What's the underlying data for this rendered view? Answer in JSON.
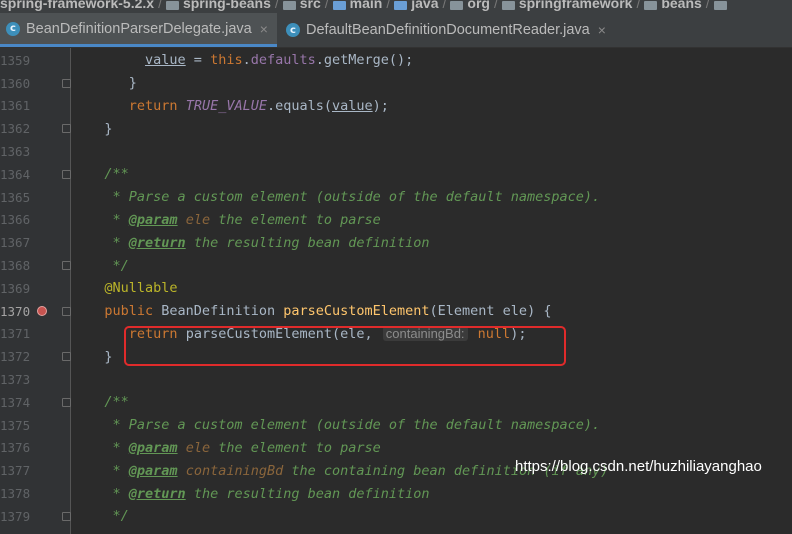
{
  "breadcrumb": {
    "items": [
      "spring-framework-5.2.x",
      "spring-beans",
      "src",
      "main",
      "java",
      "org",
      "springframework",
      "beans",
      ""
    ]
  },
  "tabs": [
    {
      "label": "BeanDefinitionParserDelegate.java",
      "icon": "class-icon",
      "active": true,
      "close": "×"
    },
    {
      "label": "DefaultBeanDefinitionDocumentReader.java",
      "icon": "class-icon",
      "active": false,
      "close": "×"
    }
  ],
  "editor": {
    "lines": [
      {
        "n": "1359",
        "tokens": [
          [
            "        ",
            ""
          ],
          [
            "value",
            "field-u"
          ],
          [
            " = ",
            "ident"
          ],
          [
            "this",
            "kw"
          ],
          [
            ".",
            "ident"
          ],
          [
            "defaults",
            "const2"
          ],
          [
            ".getMerge();",
            "ident"
          ]
        ]
      },
      {
        "n": "1360",
        "tokens": [
          [
            "      }",
            "ident"
          ]
        ]
      },
      {
        "n": "1361",
        "tokens": [
          [
            "      ",
            ""
          ],
          [
            "return ",
            "kw"
          ],
          [
            "TRUE_VALUE",
            "const"
          ],
          [
            ".equals(",
            "ident"
          ],
          [
            "value",
            "field-u"
          ],
          [
            ");",
            "ident"
          ]
        ]
      },
      {
        "n": "1362",
        "tokens": [
          [
            "   }",
            "ident"
          ]
        ]
      },
      {
        "n": "1363",
        "tokens": []
      },
      {
        "n": "1364",
        "tokens": [
          [
            "   /**",
            "doc"
          ]
        ]
      },
      {
        "n": "1365",
        "tokens": [
          [
            "    * Parse a custom element (outside of the default namespace).",
            "doc"
          ]
        ]
      },
      {
        "n": "1366",
        "tokens": [
          [
            "    * ",
            "doc"
          ],
          [
            "@param",
            "doctag"
          ],
          [
            " ",
            "doc"
          ],
          [
            "ele",
            "docparam"
          ],
          [
            " the element to parse",
            "doc"
          ]
        ]
      },
      {
        "n": "1367",
        "tokens": [
          [
            "    * ",
            "doc"
          ],
          [
            "@return",
            "doctag"
          ],
          [
            " the resulting bean definition",
            "doc"
          ]
        ]
      },
      {
        "n": "1368",
        "tokens": [
          [
            "    */",
            "doc"
          ]
        ]
      },
      {
        "n": "1369",
        "tokens": [
          [
            "   ",
            ""
          ],
          [
            "@Nullable",
            "annot"
          ]
        ]
      },
      {
        "n": "1370",
        "tokens": [
          [
            "   ",
            ""
          ],
          [
            "public ",
            "kw"
          ],
          [
            "BeanDefinition ",
            "ident"
          ],
          [
            "parseCustomElement",
            "fn"
          ],
          [
            "(Element ele) {",
            "ident"
          ]
        ],
        "current": true
      },
      {
        "n": "1371",
        "tokens": [
          [
            "      ",
            ""
          ],
          [
            "return ",
            "kw"
          ],
          [
            "parseCustomElement(ele, ",
            "ident"
          ],
          [
            "containingBd:",
            "hint"
          ],
          [
            " null",
            "kw"
          ],
          [
            ");",
            "ident"
          ]
        ]
      },
      {
        "n": "1372",
        "tokens": [
          [
            "   }",
            "ident"
          ]
        ]
      },
      {
        "n": "1373",
        "tokens": []
      },
      {
        "n": "1374",
        "tokens": [
          [
            "   /**",
            "doc"
          ]
        ]
      },
      {
        "n": "1375",
        "tokens": [
          [
            "    * Parse a custom element (outside of the default namespace).",
            "doc"
          ]
        ]
      },
      {
        "n": "1376",
        "tokens": [
          [
            "    * ",
            "doc"
          ],
          [
            "@param",
            "doctag"
          ],
          [
            " ",
            "doc"
          ],
          [
            "ele",
            "docparam"
          ],
          [
            " the element to parse",
            "doc"
          ]
        ]
      },
      {
        "n": "1377",
        "tokens": [
          [
            "    * ",
            "doc"
          ],
          [
            "@param",
            "doctag"
          ],
          [
            " ",
            "doc"
          ],
          [
            "containingBd",
            "docparam"
          ],
          [
            " the containing bean definition (if any)",
            "doc"
          ]
        ]
      },
      {
        "n": "1378",
        "tokens": [
          [
            "    * ",
            "doc"
          ],
          [
            "@return",
            "doctag"
          ],
          [
            " the resulting bean definition",
            "doc"
          ]
        ]
      },
      {
        "n": "1379",
        "tokens": [
          [
            "    */",
            "doc"
          ]
        ]
      }
    ]
  },
  "watermark": "https://blog.csdn.net/huzhiliayanghao",
  "colors": {
    "accent": "#4a88c7",
    "highlight_box": "#e02b2b"
  }
}
